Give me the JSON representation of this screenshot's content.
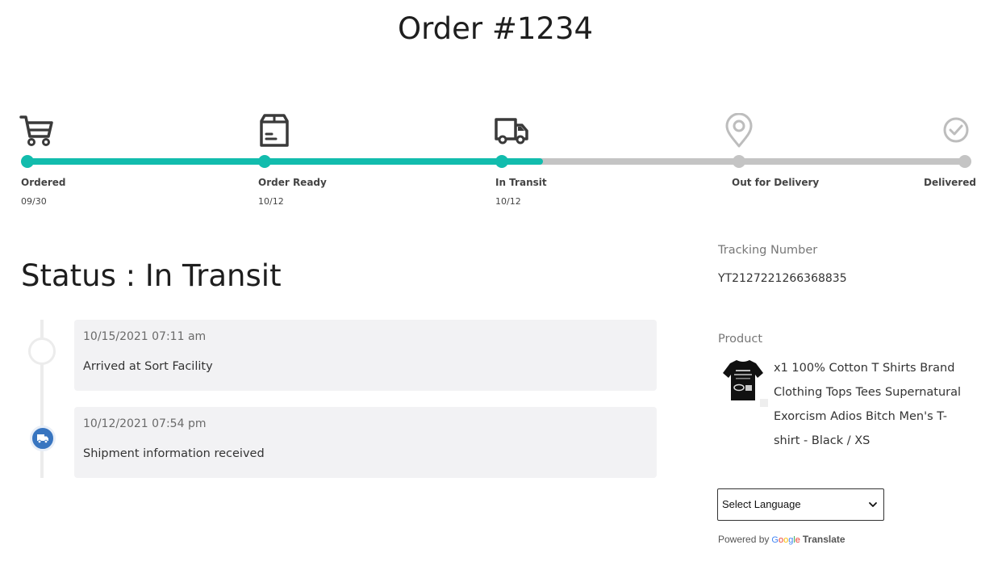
{
  "order": {
    "title": "Order #1234"
  },
  "progress": {
    "accent_color": "#12bcad",
    "inactive_color": "#c4c4c4",
    "completion_fraction": 0.55,
    "steps": [
      {
        "label": "Ordered",
        "date": "09/30",
        "icon": "cart-icon",
        "done": true
      },
      {
        "label": "Order Ready",
        "date": "10/12",
        "icon": "box-icon",
        "done": true
      },
      {
        "label": "In Transit",
        "date": "10/12",
        "icon": "truck-icon",
        "done": true
      },
      {
        "label": "Out for Delivery",
        "date": "",
        "icon": "location-pin-icon",
        "done": false
      },
      {
        "label": "Delivered",
        "date": "",
        "icon": "check-circle-icon",
        "done": false
      }
    ]
  },
  "status": {
    "title": "Status : In Transit"
  },
  "events": [
    {
      "timestamp": "10/15/2021 07:11 am",
      "description": "Arrived at Sort Facility"
    },
    {
      "timestamp": "10/12/2021 07:54 pm",
      "description": "Shipment information received"
    }
  ],
  "tracking": {
    "label": "Tracking Number",
    "number": "YT2127221266368835"
  },
  "product": {
    "label": "Product",
    "description": "x1 100% Cotton T Shirts Brand Clothing Tops Tees Supernatural Exorcism Adios Bitch Men's T-shirt - Black / XS"
  },
  "language": {
    "selected": "Select Language"
  },
  "powered_by": {
    "prefix": "Powered by",
    "brand": "Google",
    "product": "Translate"
  }
}
